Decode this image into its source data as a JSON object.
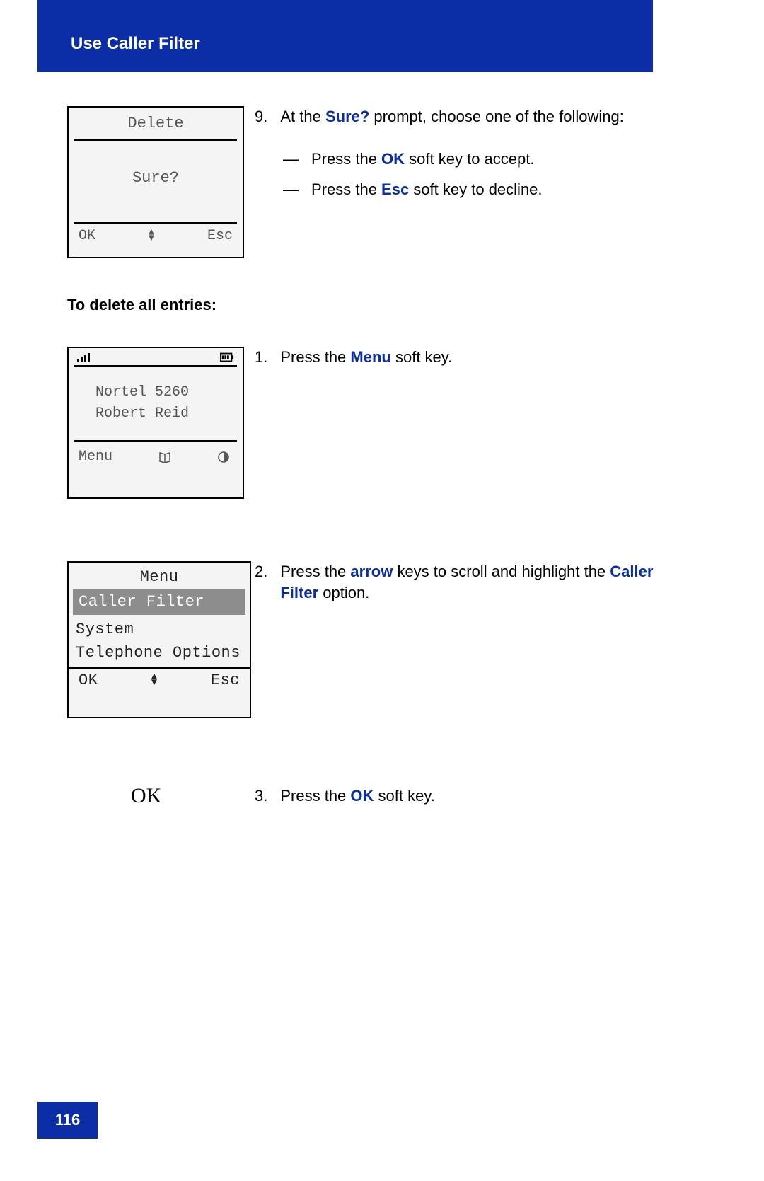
{
  "header": {
    "title": "Use Caller Filter"
  },
  "page_number": "116",
  "screen1": {
    "title": "Delete",
    "message": "Sure?",
    "left_key": "OK",
    "right_key": "Esc"
  },
  "step9": {
    "num": "9.",
    "lead_a": "At the ",
    "sure": "Sure?",
    "lead_b": " prompt, choose one of the following:",
    "bullets": [
      {
        "pre": "Press the ",
        "key": "OK",
        "post": " soft key to accept."
      },
      {
        "pre": "Press the ",
        "key": "Esc",
        "post": " soft key to decline."
      }
    ]
  },
  "subheading": "To delete all entries:",
  "screen2": {
    "line1": "Nortel 5260",
    "line2": "Robert Reid",
    "left_key": "Menu"
  },
  "step1": {
    "num": "1.",
    "pre": "Press the ",
    "key": "Menu",
    "post": " soft key."
  },
  "screen3": {
    "title": "Menu",
    "selected": "Caller Filter",
    "item2": "System",
    "item3": "Telephone Options",
    "left_key": "OK",
    "right_key": "Esc"
  },
  "step2": {
    "num": "2.",
    "pre": "Press the ",
    "key1": "arrow",
    "mid": " keys to scroll and highlight the ",
    "key2": "Caller Filter",
    "post": " option."
  },
  "ok_key_label": "OK",
  "step3": {
    "num": "3.",
    "pre": "Press the ",
    "key": "OK",
    "post": " soft key."
  }
}
